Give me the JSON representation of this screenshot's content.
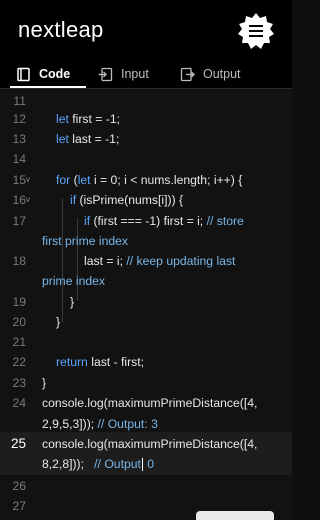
{
  "app": {
    "logo": "nextleap"
  },
  "tabs": [
    {
      "label": "Code",
      "icon": "book-icon",
      "active": true
    },
    {
      "label": "Input",
      "icon": "input-icon",
      "active": false
    },
    {
      "label": "Output",
      "icon": "output-icon",
      "active": false
    }
  ],
  "editor": {
    "active_line": "25",
    "lines": [
      {
        "n": "11",
        "text": ""
      },
      {
        "n": "12",
        "text": "let first = -1;"
      },
      {
        "n": "13",
        "text": "let last = -1;"
      },
      {
        "n": "14",
        "text": ""
      },
      {
        "n": "15",
        "text": "for (let i = 0; i < nums.length; i++) {"
      },
      {
        "n": "16",
        "text": "if (isPrime(nums[i])) {"
      },
      {
        "n": "17",
        "text": "if (first === -1) first = i; // store first prime index"
      },
      {
        "n": "18",
        "text": "last = i; // keep updating last prime index"
      },
      {
        "n": "19",
        "text": "}"
      },
      {
        "n": "20",
        "text": "}"
      },
      {
        "n": "21",
        "text": ""
      },
      {
        "n": "22",
        "text": "return last - first;"
      },
      {
        "n": "23",
        "text": "}"
      },
      {
        "n": "24",
        "text": "console.log(maximumPrimeDistance([4, 2,9,5,3])); // Output: 3"
      },
      {
        "n": "25",
        "text": "console.log(maximumPrimeDistance([4, 8,2,8]));   // Output 0"
      },
      {
        "n": "26",
        "text": ""
      },
      {
        "n": "27",
        "text": ""
      }
    ]
  },
  "colors": {
    "keyword": "#5aa5ff",
    "comment": "#78b6e8",
    "background": "#121212",
    "header": "#000000"
  }
}
